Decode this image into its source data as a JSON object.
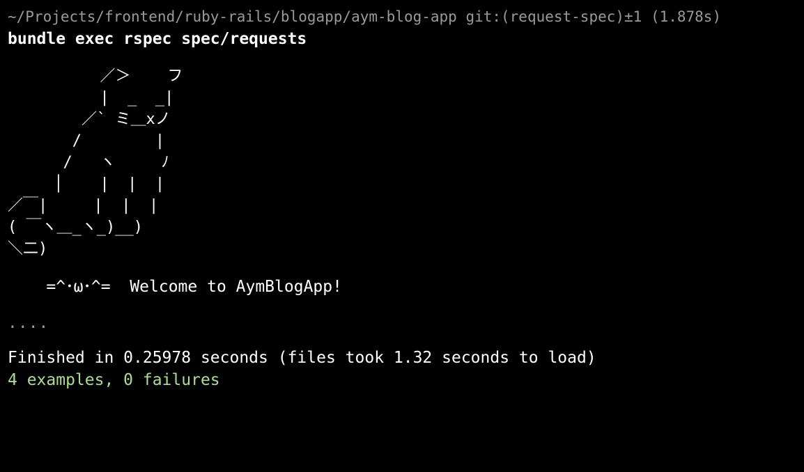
{
  "colors": {
    "background": "#000000",
    "prompt": "#9a9a9a",
    "text": "#ffffff",
    "success": "#a6e08a"
  },
  "terminal": {
    "prompt": "~/Projects/frontend/ruby-rails/blogapp/aym-blog-app git:(request-spec)±1 (1.878s)",
    "command": "bundle exec rspec spec/requests",
    "ascii_art": [
      "          ／＞    フ",
      "          |  _  _|",
      "        ／` ミ＿xノ",
      "       /        |",
      "      /   ヽ     ﾉ",
      "     │    |  |  |",
      "／￣|     |  |  |",
      "( ￣ヽ＿_ヽ_)__)",
      "＼二)"
    ],
    "welcome": "    =^･ω･^=  Welcome to AymBlogApp!",
    "progress": "....",
    "finished": "Finished in 0.25978 seconds (files took 1.32 seconds to load)",
    "summary": "4 examples, 0 failures"
  }
}
